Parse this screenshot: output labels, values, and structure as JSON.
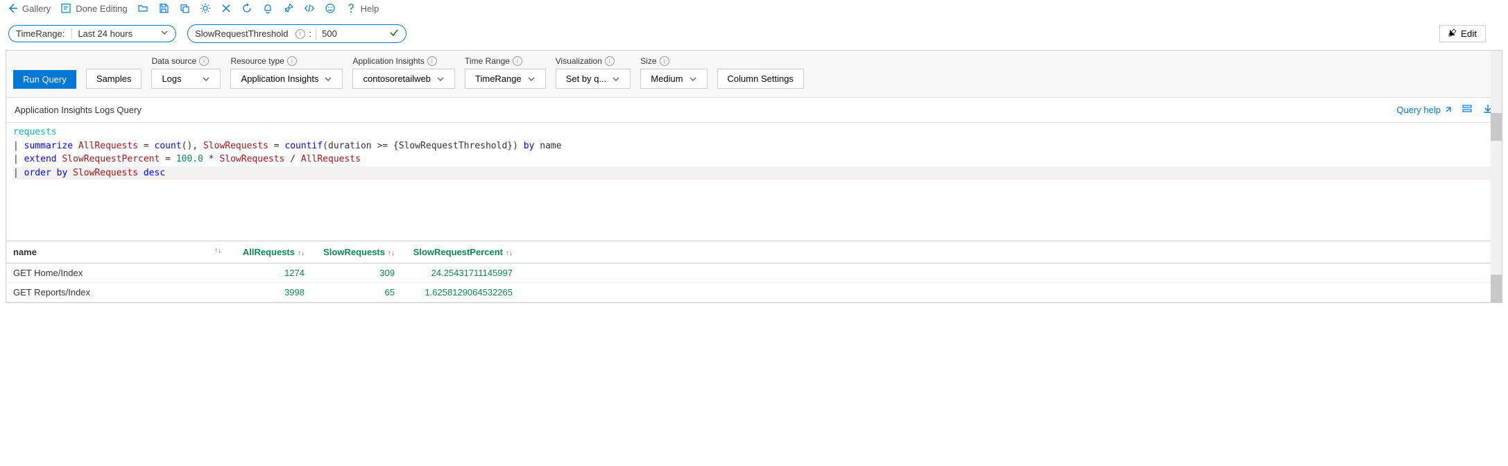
{
  "toolbar": {
    "gallery": "Gallery",
    "done_editing": "Done Editing",
    "help": "Help"
  },
  "params": {
    "time_range_label": "TimeRange:",
    "time_range_value": "Last 24 hours",
    "threshold_label": "SlowRequestThreshold",
    "threshold_colon": ":",
    "threshold_value": "500"
  },
  "edit_button": "Edit",
  "query_header": {
    "run_query": "Run Query",
    "samples": "Samples",
    "data_source_label": "Data source",
    "data_source_value": "Logs",
    "resource_type_label": "Resource type",
    "resource_type_value": "Application Insights",
    "app_insights_label": "Application Insights",
    "app_insights_value": "contosoretailweb",
    "time_range_label": "Time Range",
    "time_range_value": "TimeRange",
    "visualization_label": "Visualization",
    "visualization_value": "Set by q...",
    "size_label": "Size",
    "size_value": "Medium",
    "column_settings": "Column Settings"
  },
  "panel_title": "Application Insights Logs Query",
  "panel_actions": {
    "query_help": "Query help"
  },
  "query_code": {
    "line1_table": "requests",
    "line2_pipe": "| ",
    "line2_kw1": "summarize",
    "line2_id1": " AllRequests",
    "line2_eq1": " = ",
    "line2_fn1": "count",
    "line2_par1": "(), ",
    "line2_id2": "SlowRequests",
    "line2_eq2": " = ",
    "line2_fn2": "countif",
    "line2_par2": "(duration >= {SlowRequestThreshold}) ",
    "line2_kw2": "by",
    "line2_end": " name",
    "line3_pipe": "| ",
    "line3_kw": "extend",
    "line3_id1": " SlowRequestPercent",
    "line3_eq": " = ",
    "line3_num": "100.0",
    "line3_op": " * ",
    "line3_id2": "SlowRequests",
    "line3_op2": " / ",
    "line3_id3": "AllRequests",
    "line4_pipe": "| ",
    "line4_kw1": "order",
    "line4_kw2": " by",
    "line4_id": " SlowRequests",
    "line4_kw3": " desc"
  },
  "results": {
    "headers": {
      "name": "name",
      "all": "AllRequests",
      "slow": "SlowRequests",
      "pct": "SlowRequestPercent"
    },
    "rows": [
      {
        "name": "GET Home/Index",
        "all": "1274",
        "slow": "309",
        "pct": "24.25431711145997"
      },
      {
        "name": "GET Reports/Index",
        "all": "3998",
        "slow": "65",
        "pct": "1.6258129064532265"
      }
    ]
  }
}
